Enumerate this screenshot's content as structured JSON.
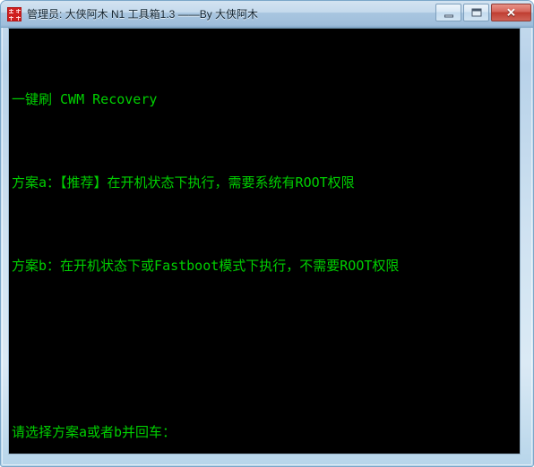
{
  "window": {
    "title": "管理员: 大侠阿木 N1 工具箱1.3 ——By 大侠阿木",
    "icon_name": "app-icon-red-seal",
    "colors": {
      "frame": "#c4d9ec",
      "titlebar_text": "#10222e",
      "console_background": "#000000",
      "console_text": "#00cf00",
      "close_button": "#bf3d31"
    }
  },
  "window_buttons": {
    "minimize_label": "",
    "maximize_label": "",
    "close_label": "✕"
  },
  "console": {
    "lines": [
      "一键刷 CWM Recovery",
      "方案a：【推荐】在开机状态下执行，需要系统有ROOT权限",
      "方案b：在开机状态下或Fastboot模式下执行，不需要ROOT权限",
      "",
      "请选择方案a或者b并回车："
    ],
    "line_0": "一键刷 CWM Recovery",
    "line_1": "方案a：【推荐】在开机状态下执行，需要系统有ROOT权限",
    "line_2": "方案b：在开机状态下或Fastboot模式下执行，不需要ROOT权限",
    "line_3": "",
    "line_4": "请选择方案a或者b并回车："
  }
}
